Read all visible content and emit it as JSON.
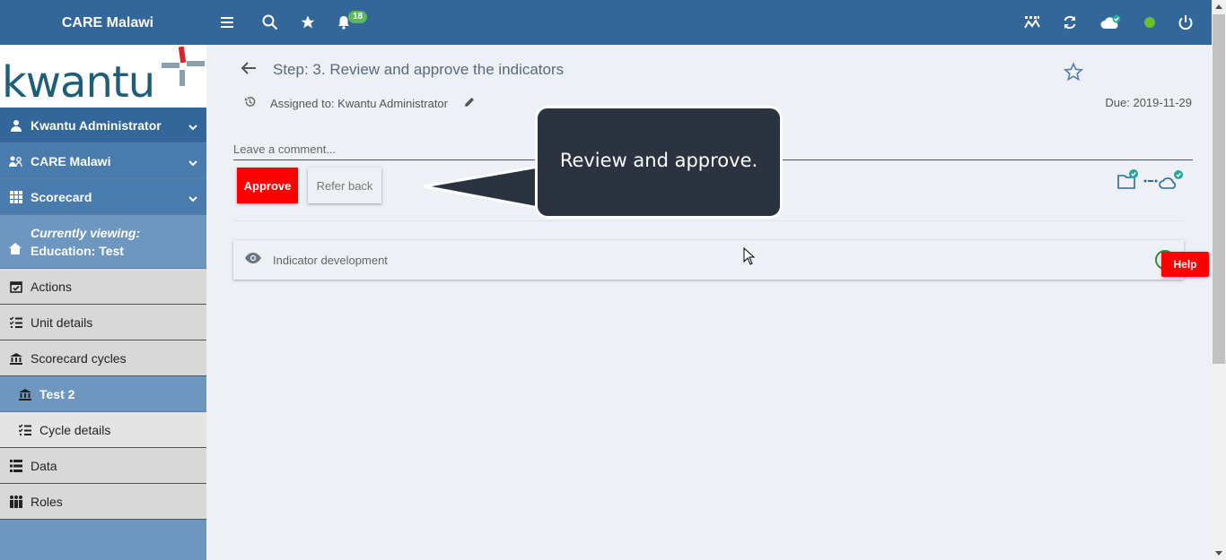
{
  "header": {
    "app_title": "CARE Malawi",
    "notification_count": "18",
    "icons": [
      "menu-icon",
      "search-icon",
      "star-icon",
      "bell-icon",
      "dashboard-icon",
      "refresh-icon",
      "cloud-sync-icon",
      "online-status-icon",
      "power-icon"
    ]
  },
  "sidebar": {
    "logo_text": "kwantu",
    "user_label": "Kwantu Administrator",
    "org_label": "CARE Malawi",
    "scorecard_label": "Scorecard",
    "viewing_prefix": "Currently viewing:",
    "viewing_value": "Education: Test",
    "items": [
      {
        "label": "Actions",
        "icon": "calendar-check-icon"
      },
      {
        "label": "Unit details",
        "icon": "checklist-icon"
      },
      {
        "label": "Scorecard cycles",
        "icon": "institution-icon"
      },
      {
        "label": "Test 2",
        "icon": "institution-icon"
      },
      {
        "label": "Cycle details",
        "icon": "checklist-icon"
      },
      {
        "label": "Data",
        "icon": "list-icon"
      },
      {
        "label": "Roles",
        "icon": "people-icon"
      }
    ]
  },
  "main": {
    "step_title": "Step: 3. Review and approve the indicators",
    "assigned_to": "Assigned to: Kwantu Administrator",
    "due": "Due: 2019-11-29",
    "comment_placeholder": "Leave a comment...",
    "approve_label": "Approve",
    "refer_back_label": "Refer back",
    "panel_label": "Indicator development",
    "help_label": "Help"
  },
  "tooltip": {
    "text": "Review and approve."
  },
  "colors": {
    "header": "#336699",
    "approve": "#ff0000",
    "tooltip_bg": "#2b3340"
  }
}
